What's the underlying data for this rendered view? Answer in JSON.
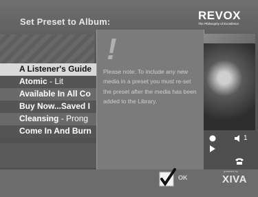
{
  "header": {
    "title": "Set Preset to Album:",
    "logo": {
      "brand": "REVOX",
      "tagline": "The Philosophy of Excellence"
    }
  },
  "albums": [
    {
      "title": "A Listener's Guide",
      "artist": ""
    },
    {
      "title": "Atomic",
      "artist": " - Lit"
    },
    {
      "title": "Available In All Co",
      "artist": ""
    },
    {
      "title": "Buy Now...Saved I",
      "artist": ""
    },
    {
      "title": "Cleansing",
      "artist": " - Prong"
    },
    {
      "title": "Come In And Burn",
      "artist": ""
    }
  ],
  "selected_index": 0,
  "dialog": {
    "symbol": "!",
    "note": "Please note: To include any new media in a preset you must re-set the preset after the media has been added to the Library."
  },
  "footer": {
    "ok_label": "OK",
    "brand": "XIVA",
    "brand_small": "powered by"
  },
  "controls": {
    "volume_label": "1"
  },
  "icons": {
    "ok": "checkmark-icon",
    "record": "record-icon",
    "play": "play-icon",
    "speaker": "speaker-icon",
    "phone": "phone-icon"
  },
  "colors": {
    "selection": "#d9d9d9",
    "dialog_bg": "#7b7b7b"
  }
}
